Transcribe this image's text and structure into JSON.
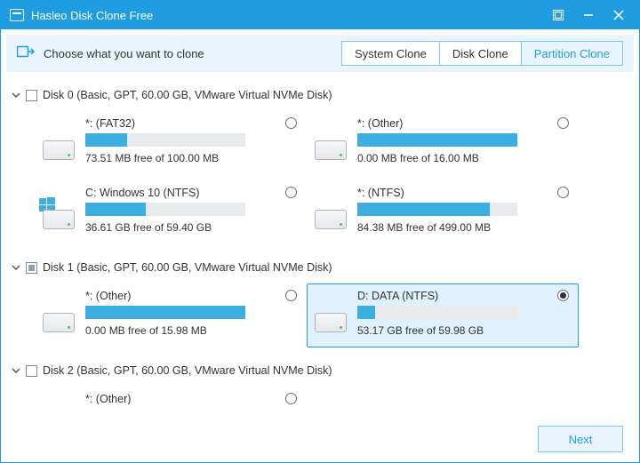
{
  "titlebar": {
    "title": "Hasleo Disk Clone Free"
  },
  "header": {
    "label": "Choose what you want to clone",
    "modes": [
      "System Clone",
      "Disk Clone",
      "Partition Clone"
    ],
    "active_mode": 2
  },
  "disks": [
    {
      "title": "Disk 0 (Basic, GPT, 60.00 GB,  VMware Virtual NVMe Disk)",
      "expanded": true,
      "check": "none",
      "partitions": [
        {
          "name": "*: (FAT32)",
          "free": "73.51 MB free of 100.00 MB",
          "fill_pct": 26,
          "selected": false,
          "os_icon": false
        },
        {
          "name": "*: (Other)",
          "free": "0.00 MB free of 16.00 MB",
          "fill_pct": 100,
          "selected": false,
          "os_icon": false
        },
        {
          "name": "C: Windows 10 (NTFS)",
          "free": "36.61 GB free of 59.40 GB",
          "fill_pct": 38,
          "selected": false,
          "os_icon": true
        },
        {
          "name": "*: (NTFS)",
          "free": "84.38 MB free of 499.00 MB",
          "fill_pct": 83,
          "selected": false,
          "os_icon": false
        }
      ]
    },
    {
      "title": "Disk 1 (Basic, GPT, 60.00 GB,  VMware Virtual NVMe Disk)",
      "expanded": true,
      "check": "semi",
      "partitions": [
        {
          "name": "*: (Other)",
          "free": "0.00 MB free of 15.98 MB",
          "fill_pct": 100,
          "selected": false,
          "os_icon": false
        },
        {
          "name": "D: DATA (NTFS)",
          "free": "53.17 GB free of 59.98 GB",
          "fill_pct": 11,
          "selected": true,
          "os_icon": false
        }
      ]
    },
    {
      "title": "Disk 2 (Basic, GPT, 60.00 GB,  VMware Virtual NVMe Disk)",
      "expanded": true,
      "check": "none",
      "partitions": [
        {
          "name": "*: (Other)",
          "free": "",
          "fill_pct": 0,
          "selected": false,
          "os_icon": false
        }
      ]
    }
  ],
  "footer": {
    "next": "Next"
  }
}
